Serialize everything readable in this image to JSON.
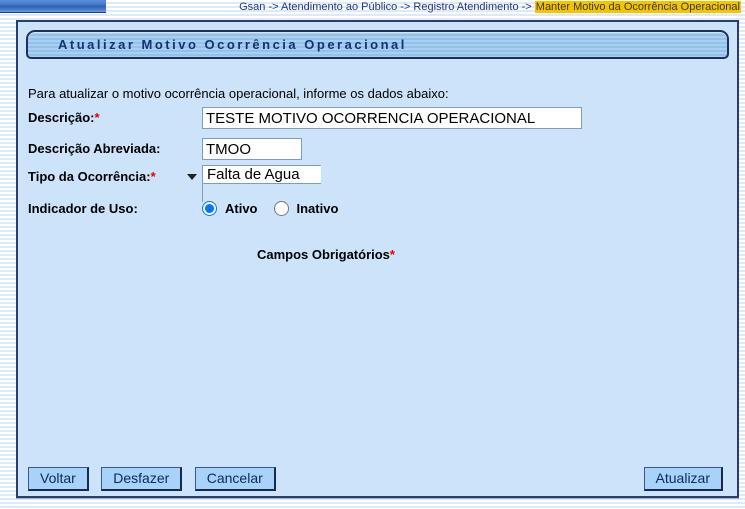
{
  "breadcrumb": {
    "prefix": "Gsan -> Atendimento ao Público -> Registro Atendimento -> ",
    "highlighted": "Manter Motivo da Ocorrência Operacional"
  },
  "panel": {
    "title": "Atualizar Motivo Ocorrência Operacional",
    "instructions": "Para atualizar o motivo ocorrência operacional, informe os dados abaixo:",
    "fields": {
      "descricao": {
        "label": "Descrição:",
        "required_mark": "*",
        "value": "TESTE MOTIVO OCORRENCIA OPERACIONAL"
      },
      "descricao_abreviada": {
        "label": "Descrição Abreviada:",
        "value": "TMOO"
      },
      "tipo_ocorrencia": {
        "label": "Tipo da Ocorrência:",
        "required_mark": "*",
        "selected": "Falta de Agua"
      },
      "indicador_uso": {
        "label": "Indicador de Uso:",
        "options": [
          {
            "label": "Ativo",
            "checked": true
          },
          {
            "label": "Inativo",
            "checked": false
          }
        ]
      }
    },
    "required_note": {
      "text": "Campos Obrigatórios",
      "asterisk": "*"
    },
    "buttons": {
      "voltar": "Voltar",
      "desfazer": "Desfazer",
      "cancelar": "Cancelar",
      "atualizar": "Atualizar"
    }
  },
  "colors": {
    "panel_fill": "#cde3fa",
    "panel_border": "#2b3d6b",
    "titlebar_stripe": "#92c1ea",
    "breadcrumb_highlight": "#f5c400",
    "button_fill": "#a9d2f8",
    "required_red": "#e60000"
  }
}
